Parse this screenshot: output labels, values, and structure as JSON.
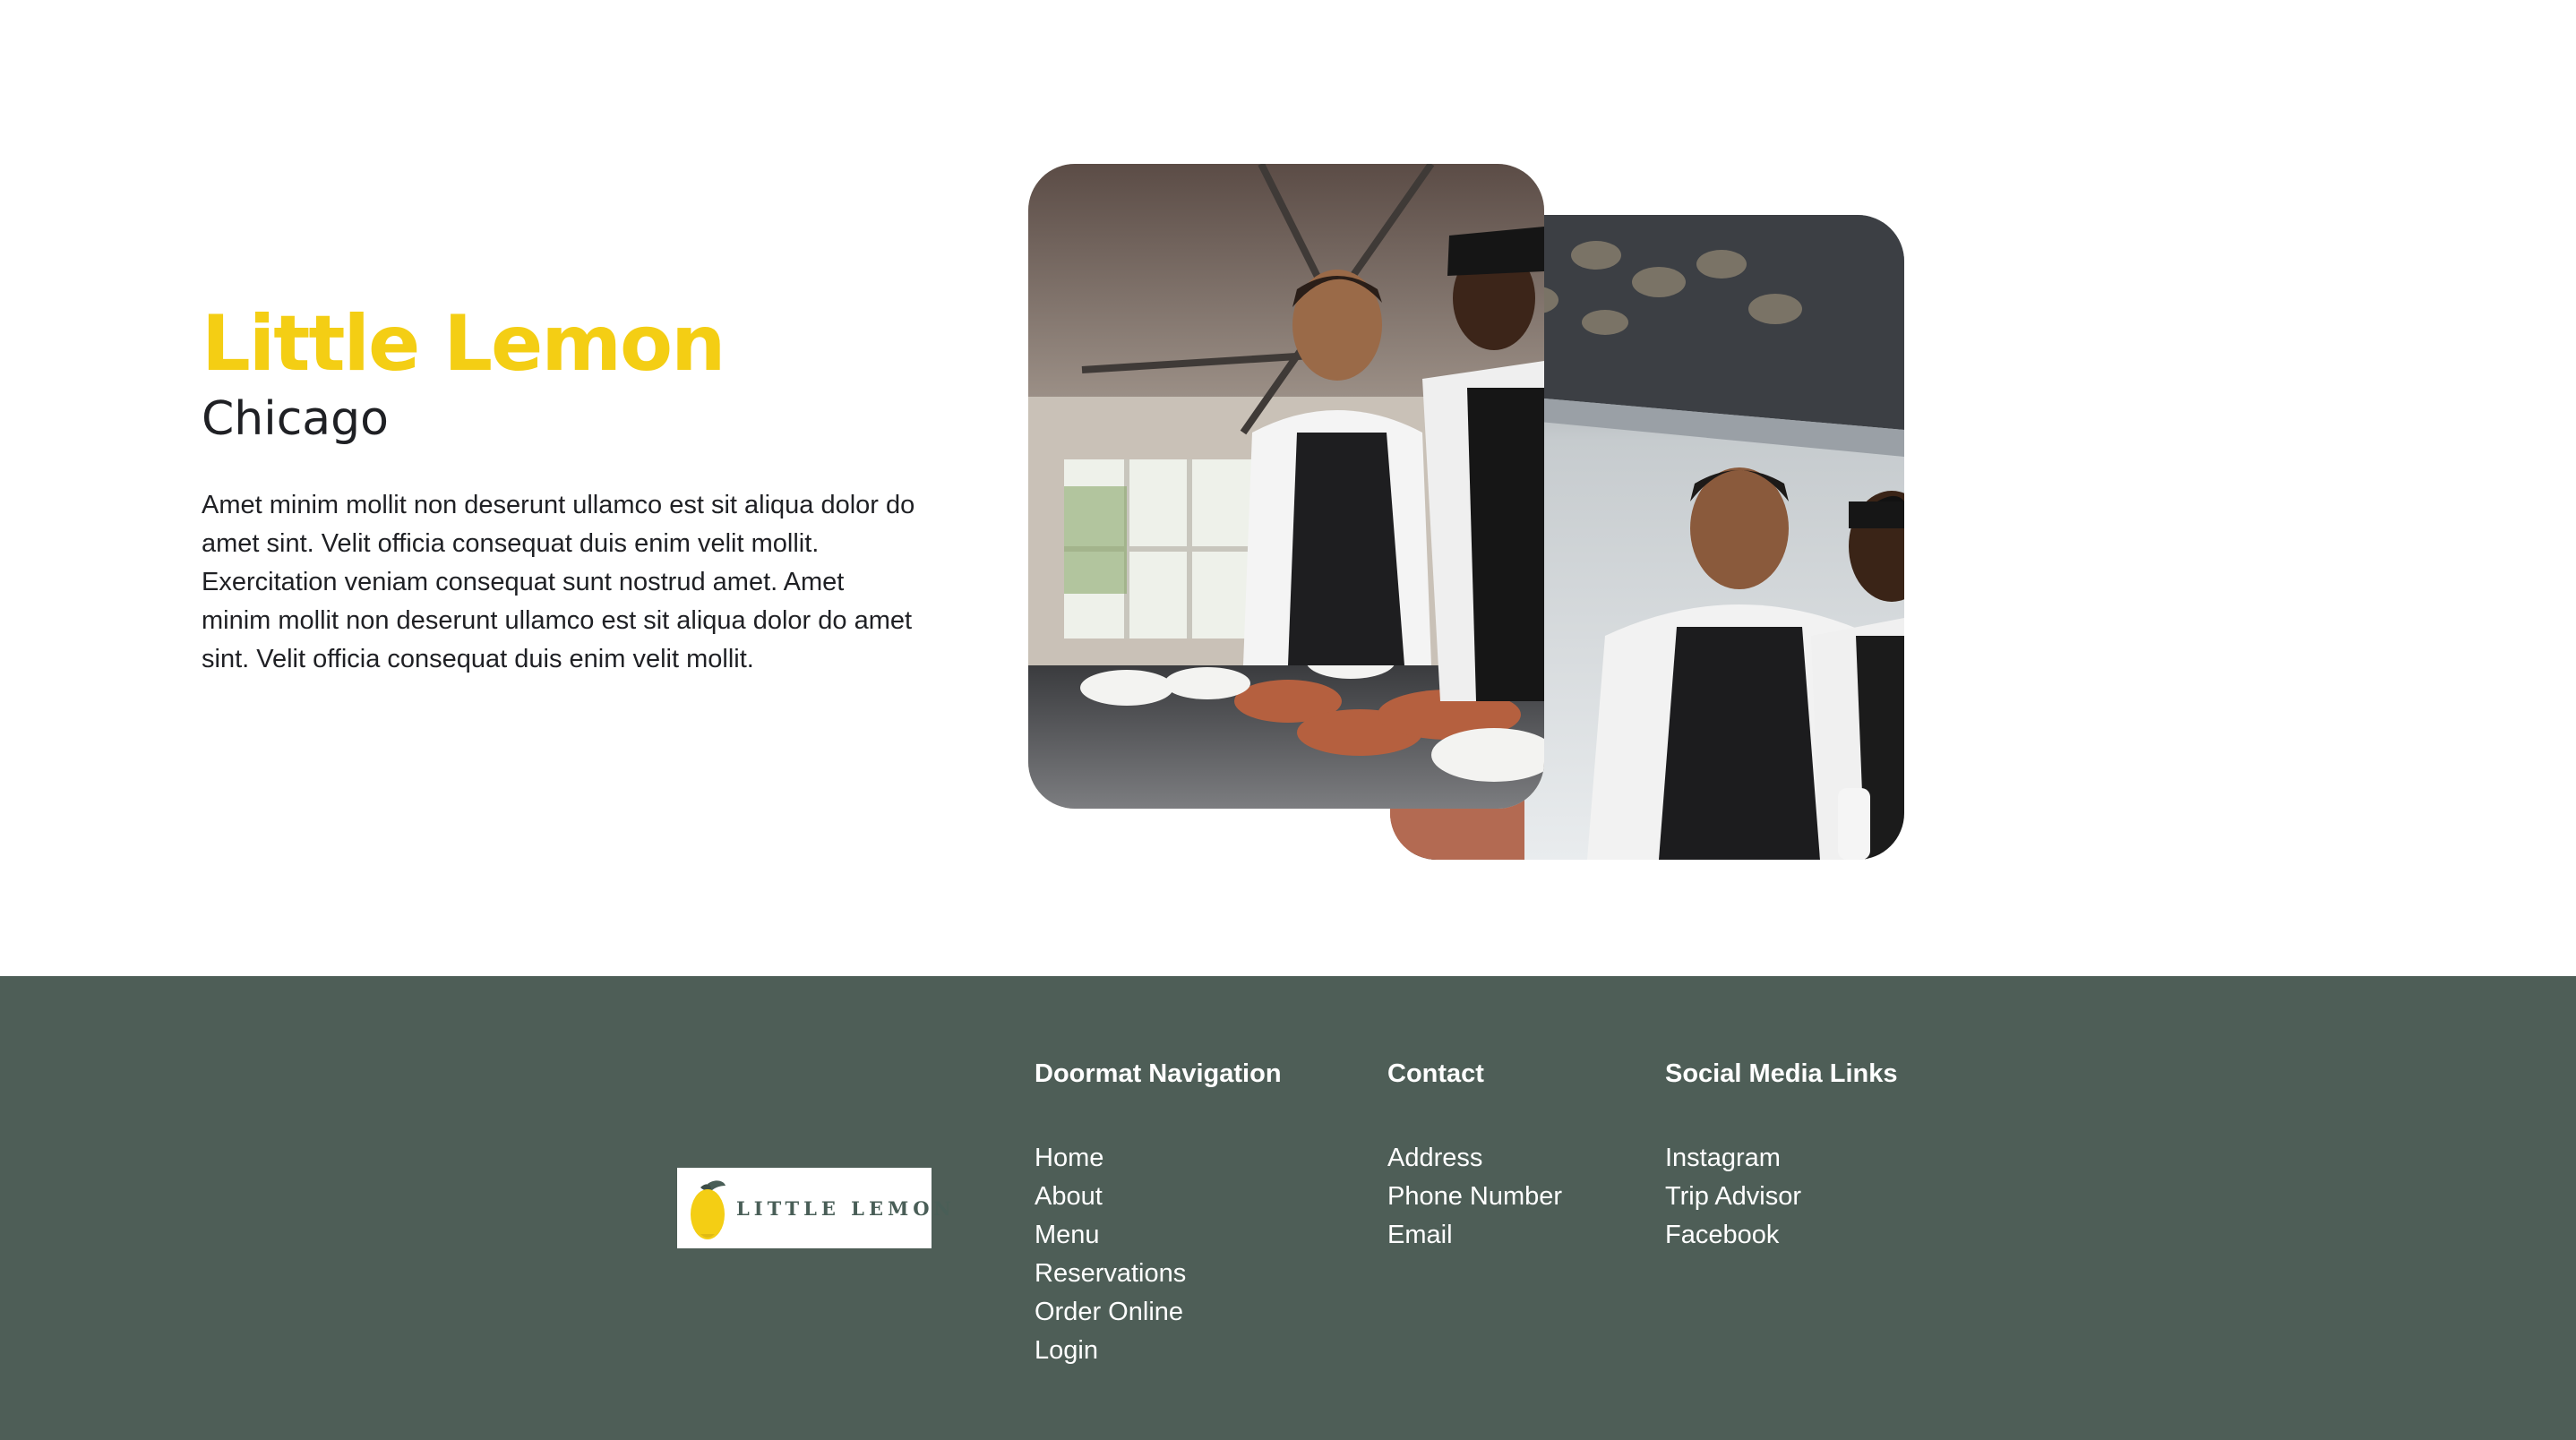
{
  "about": {
    "title": "Little Lemon",
    "subtitle": "Chicago",
    "description": "Amet minim mollit non deserunt ullamco est sit aliqua dolor do amet sint. Velit officia consequat duis enim velit mollit. Exercitation veniam consequat sunt nostrud amet. Amet minim mollit non deserunt ullamco est sit aliqua dolor do amet sint. Velit officia consequat duis enim velit mollit."
  },
  "footer": {
    "logo_text": "LITTLE LEMON",
    "navigation": {
      "heading": "Doormat Navigation",
      "items": [
        "Home",
        "About",
        "Menu",
        "Reservations",
        "Order Online",
        "Login"
      ]
    },
    "contact": {
      "heading": "Contact",
      "items": [
        "Address",
        "Phone Number",
        "Email"
      ]
    },
    "social": {
      "heading": "Social Media Links",
      "items": [
        "Instagram",
        "Trip Advisor",
        "Facebook"
      ]
    }
  },
  "colors": {
    "brand_yellow": "#f4ce14",
    "brand_green": "#4e5e57",
    "text_dark": "#1f2024",
    "white": "#ffffff"
  },
  "icons": [
    "lemon-logo-icon"
  ]
}
